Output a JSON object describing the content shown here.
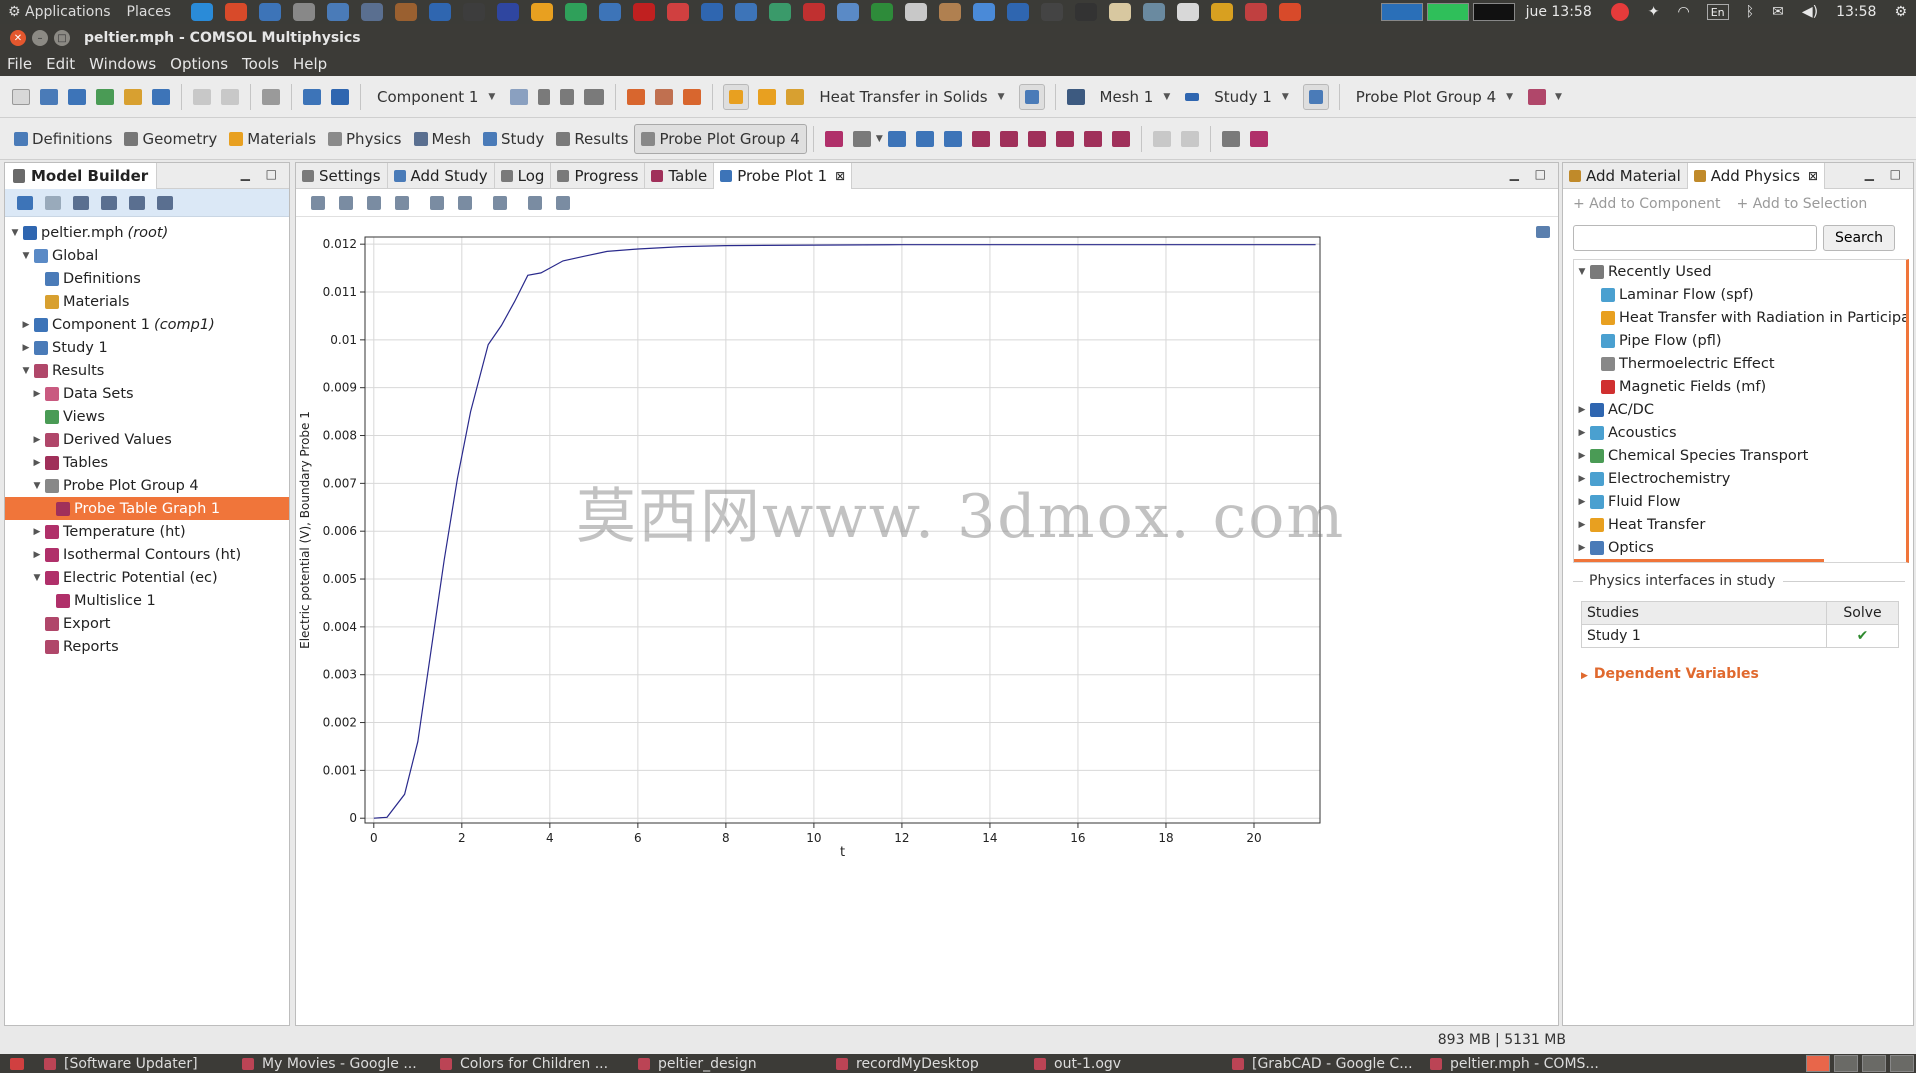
{
  "top_panel": {
    "applications": "Applications",
    "places": "Places",
    "launcher_icons": [
      "skype-icon",
      "chrome-icon",
      "sphere-icon",
      "mail-icon",
      "network-icon",
      "disk-icon",
      "gimp-icon",
      "kde-icon",
      "inkscape-icon",
      "shield-icon",
      "sun-icon",
      "color-icon",
      "box-icon",
      "filezilla-icon",
      "firefox-icon",
      "r-icon",
      "matlab-icon",
      "globe-icon",
      "m-icon",
      "doc-icon",
      "earth-icon",
      "chart-icon",
      "folder-icon",
      "globe2-icon",
      "toefl-icon",
      "tool-icon",
      "plane-icon",
      "file-icon",
      "search-icon",
      "book-icon",
      "pepper-icon",
      "ball-icon",
      "catia-icon"
    ],
    "date_label": "jue 13:58",
    "time_label": "13:58",
    "keyboard_label": "En"
  },
  "window": {
    "title": "peltier.mph - COMSOL Multiphysics"
  },
  "menu": [
    "File",
    "Edit",
    "Windows",
    "Options",
    "Tools",
    "Help"
  ],
  "toolbar": {
    "component_combo": "Component 1",
    "physics_combo": "Heat Transfer in Solids",
    "mesh_combo": "Mesh 1",
    "study_combo": "Study 1",
    "plot_group_combo": "Probe Plot Group 4"
  },
  "ribbon": {
    "tabs": [
      "Definitions",
      "Geometry",
      "Materials",
      "Physics",
      "Mesh",
      "Study",
      "Results",
      "Probe Plot Group 4"
    ]
  },
  "model_builder": {
    "title": "Model Builder",
    "tree": [
      {
        "label": "peltier.mph",
        "suffix": "(root)",
        "level": 0,
        "arrow": "▼",
        "icon": "#2f66b0"
      },
      {
        "label": "Global",
        "suffix": "",
        "level": 1,
        "arrow": "▼",
        "icon": "#5a8ac6"
      },
      {
        "label": "Definitions",
        "suffix": "",
        "level": 2,
        "arrow": "",
        "icon": "#4a7bb8"
      },
      {
        "label": "Materials",
        "suffix": "",
        "level": 2,
        "arrow": "",
        "icon": "#d8a030"
      },
      {
        "label": "Component 1",
        "suffix": "(comp1)",
        "level": 1,
        "arrow": "▶",
        "icon": "#3d74b8"
      },
      {
        "label": "Study 1",
        "suffix": "",
        "level": 1,
        "arrow": "▶",
        "icon": "#4a7bb8"
      },
      {
        "label": "Results",
        "suffix": "",
        "level": 1,
        "arrow": "▼",
        "icon": "#b0476a"
      },
      {
        "label": "Data Sets",
        "suffix": "",
        "level": 2,
        "arrow": "▶",
        "icon": "#c95a80"
      },
      {
        "label": "Views",
        "suffix": "",
        "level": 2,
        "arrow": "",
        "icon": "#4a9b55"
      },
      {
        "label": "Derived Values",
        "suffix": "",
        "level": 2,
        "arrow": "▶",
        "icon": "#b0476a"
      },
      {
        "label": "Tables",
        "suffix": "",
        "level": 2,
        "arrow": "▶",
        "icon": "#a0305a"
      },
      {
        "label": "Probe Plot Group 4",
        "suffix": "",
        "level": 2,
        "arrow": "▼",
        "icon": "#888888"
      },
      {
        "label": "Probe Table Graph 1",
        "suffix": "",
        "level": 3,
        "arrow": "",
        "icon": "#a0305a",
        "selected": true
      },
      {
        "label": "Temperature (ht)",
        "suffix": "",
        "level": 2,
        "arrow": "▶",
        "icon": "#b0306a"
      },
      {
        "label": "Isothermal Contours (ht)",
        "suffix": "",
        "level": 2,
        "arrow": "▶",
        "icon": "#b0306a"
      },
      {
        "label": "Electric Potential (ec)",
        "suffix": "",
        "level": 2,
        "arrow": "▼",
        "icon": "#b0306a"
      },
      {
        "label": "Multislice 1",
        "suffix": "",
        "level": 3,
        "arrow": "",
        "icon": "#b0306a"
      },
      {
        "label": "Export",
        "suffix": "",
        "level": 2,
        "arrow": "",
        "icon": "#b0476a"
      },
      {
        "label": "Reports",
        "suffix": "",
        "level": 2,
        "arrow": "",
        "icon": "#b0476a"
      }
    ]
  },
  "graphics": {
    "tabs": [
      {
        "label": "Settings",
        "icon": "#7a7a7a"
      },
      {
        "label": "Add Study",
        "icon": "#4a7bb8"
      },
      {
        "label": "Log",
        "icon": "#7a7a7a"
      },
      {
        "label": "Progress",
        "icon": "#7a7a7a"
      },
      {
        "label": "Table",
        "icon": "#a0305a"
      },
      {
        "label": "Probe Plot 1",
        "icon": "#3d74b8",
        "active": true,
        "closable": true
      }
    ],
    "watermark": "莫西网www. 3dmox. com"
  },
  "chart_data": {
    "type": "line",
    "title": "",
    "xlabel": "t",
    "ylabel": "Electric potential (V), Boundary Probe 1",
    "xlim": [
      -0.2,
      21.5
    ],
    "ylim": [
      -0.0001,
      0.01215
    ],
    "x_ticks": [
      "0",
      "2",
      "4",
      "6",
      "8",
      "10",
      "12",
      "14",
      "16",
      "18",
      "20"
    ],
    "y_ticks": [
      "0",
      "0.001",
      "0.002",
      "0.003",
      "0.004",
      "0.005",
      "0.006",
      "0.007",
      "0.008",
      "0.009",
      "0.01",
      "0.011",
      "0.012"
    ],
    "x_tick_values": [
      0,
      2,
      4,
      6,
      8,
      10,
      12,
      14,
      16,
      18,
      20
    ],
    "y_tick_values": [
      0,
      0.001,
      0.002,
      0.003,
      0.004,
      0.005,
      0.006,
      0.007,
      0.008,
      0.009,
      0.01,
      0.011,
      0.012
    ],
    "grid": true,
    "line_color": "#2a2a8c",
    "series": [
      {
        "x": [
          0,
          0.3,
          0.7,
          1.0,
          1.3,
          1.6,
          1.9,
          2.2,
          2.6,
          2.9,
          3.2,
          3.5,
          3.8,
          4.0,
          4.3,
          4.8,
          5.3,
          6.0,
          7.0,
          8.0,
          10.0,
          12.0,
          14.0,
          16.0,
          18.0,
          20.0,
          21.4
        ],
        "y": [
          0,
          2e-05,
          0.0005,
          0.0016,
          0.0035,
          0.0054,
          0.0071,
          0.0085,
          0.0099,
          0.0103,
          0.0108,
          0.01135,
          0.0114,
          0.0115,
          0.01165,
          0.01175,
          0.01185,
          0.0119,
          0.01195,
          0.01197,
          0.01198,
          0.01199,
          0.01199,
          0.01199,
          0.01199,
          0.01199,
          0.01199
        ]
      }
    ]
  },
  "right_panel": {
    "tabs": [
      {
        "label": "Add Material",
        "active": false
      },
      {
        "label": "Add Physics",
        "active": true,
        "closable": true
      }
    ],
    "actions": [
      "+ Add to Component",
      "+ Add to Selection"
    ],
    "search_value": "",
    "search_button": "Search",
    "physics_tree": [
      {
        "label": "Recently Used",
        "level": 0,
        "arrow": "▼",
        "icon": "#7a7a7a"
      },
      {
        "label": "Laminar Flow (spf)",
        "level": 1,
        "arrow": "",
        "icon": "#4aa0d0"
      },
      {
        "label": "Heat Transfer with Radiation in Participat",
        "level": 1,
        "arrow": "",
        "icon": "#e8a020"
      },
      {
        "label": "Pipe Flow (pfl)",
        "level": 1,
        "arrow": "",
        "icon": "#4aa0d0"
      },
      {
        "label": "Thermoelectric Effect",
        "level": 1,
        "arrow": "",
        "icon": "#888888"
      },
      {
        "label": "Magnetic Fields (mf)",
        "level": 1,
        "arrow": "",
        "icon": "#d03030"
      },
      {
        "label": "AC/DC",
        "level": 0,
        "arrow": "▶",
        "icon": "#2f66b0"
      },
      {
        "label": "Acoustics",
        "level": 0,
        "arrow": "▶",
        "icon": "#4aa0d0"
      },
      {
        "label": "Chemical Species Transport",
        "level": 0,
        "arrow": "▶",
        "icon": "#4a9b55"
      },
      {
        "label": "Electrochemistry",
        "level": 0,
        "arrow": "▶",
        "icon": "#4aa0d0"
      },
      {
        "label": "Fluid Flow",
        "level": 0,
        "arrow": "▶",
        "icon": "#4aa0d0"
      },
      {
        "label": "Heat Transfer",
        "level": 0,
        "arrow": "▶",
        "icon": "#e8a020"
      },
      {
        "label": "Optics",
        "level": 0,
        "arrow": "▶",
        "icon": "#4a7bb8"
      }
    ],
    "interfaces_header": "Physics interfaces in study",
    "studies_header": "Studies",
    "solve_header": "Solve",
    "studies": [
      {
        "name": "Study 1",
        "solve": "✔"
      }
    ],
    "dependent_variables": "Dependent Variables"
  },
  "status": {
    "memory": "893 MB | 5131 MB"
  },
  "taskbar": {
    "tasks": [
      "[Software Updater]",
      "My Movies - Google ...",
      "Colors for Children ...",
      "peltier_design",
      "recordMyDesktop",
      "out-1.ogv",
      "[GrabCAD - Google C...",
      "peltier.mph - COMS..."
    ]
  }
}
